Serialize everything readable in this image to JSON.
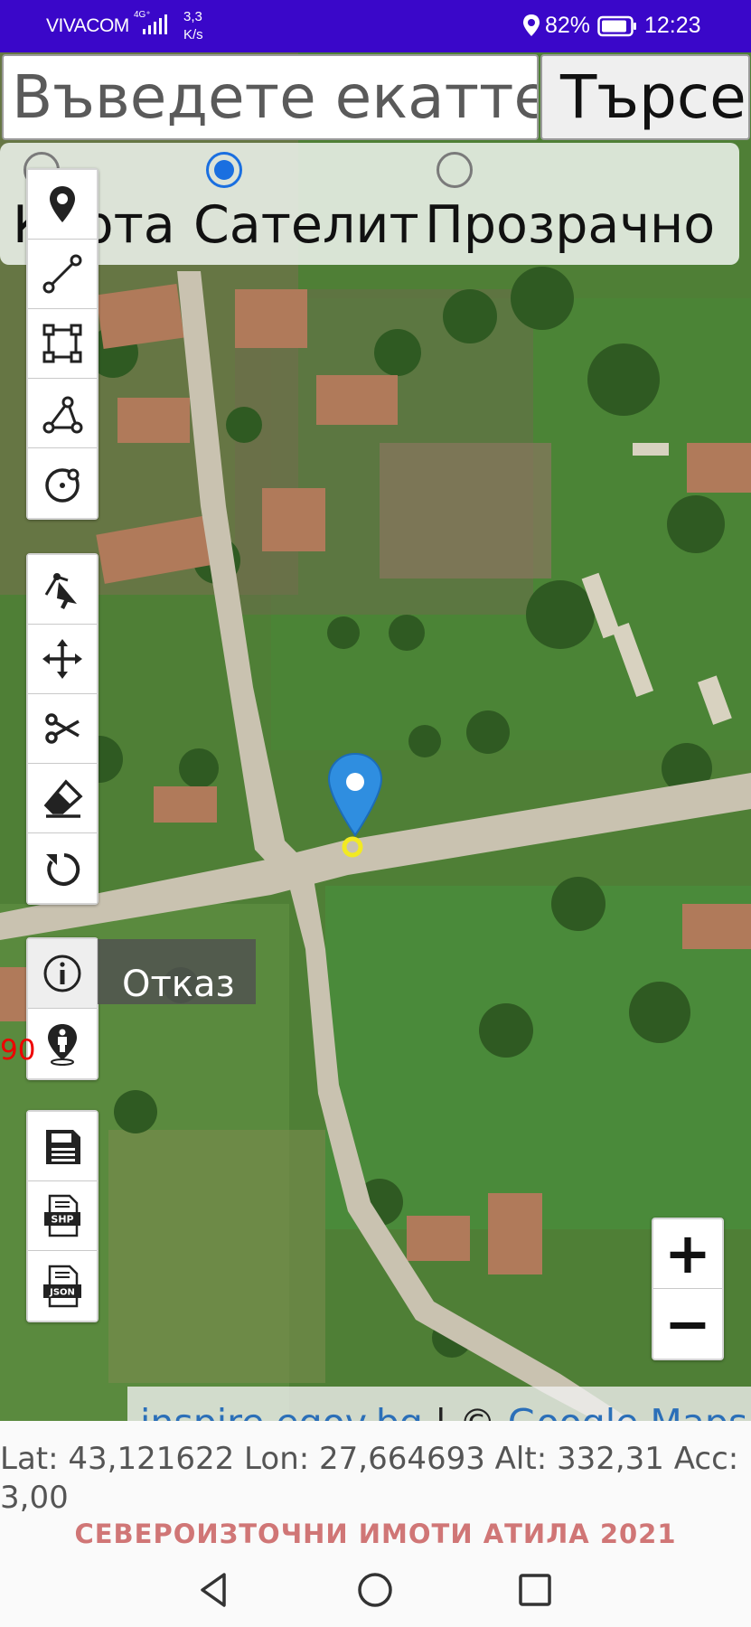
{
  "status_bar": {
    "carrier": "VIVACOM",
    "network": "4G⁺",
    "speed": "3,3\nK/s",
    "battery": "82%",
    "time": "12:23"
  },
  "search": {
    "placeholder": "Въведете екатте",
    "button_label": "Търсене"
  },
  "map_type": {
    "options": [
      {
        "label": "Карта",
        "checked": false
      },
      {
        "label": "Сателит",
        "checked": true
      },
      {
        "label": "Прозрачно",
        "checked": false
      }
    ]
  },
  "toolbar": {
    "draw_tools": [
      "marker-icon",
      "polyline-icon",
      "rectangle-icon",
      "polygon-icon",
      "circle-icon"
    ],
    "edit_tools": [
      "select-icon",
      "move-icon",
      "cut-icon",
      "eraser-icon",
      "rotate-icon"
    ],
    "info_tools": [
      "info-icon",
      "person-location-icon"
    ],
    "file_tools": [
      "save-icon",
      "shp-export-icon",
      "json-export-icon"
    ],
    "shp_text": "SHP",
    "json_text": "JSON"
  },
  "popup": {
    "cancel_label": "Отказ"
  },
  "map_overlay": {
    "red_text": "90"
  },
  "zoom": {
    "in_label": "+",
    "out_label": "−"
  },
  "attribution": {
    "link1": "inspire.egov.bg",
    "separator": " | © ",
    "link2": "Google Maps"
  },
  "position": {
    "text": "Lat: 43,121622 Lon: 27,664693 Alt: 332,31 Acc: 3,00"
  },
  "footer": {
    "brand": "СЕВЕРОИЗТОЧНИ ИМОТИ АТИЛА 2021"
  },
  "colors": {
    "status_bar": "#3a07c9",
    "radio_accent": "#1a6fe0",
    "marker_blue": "#2f8ee0",
    "brand_text": "#d07676"
  }
}
